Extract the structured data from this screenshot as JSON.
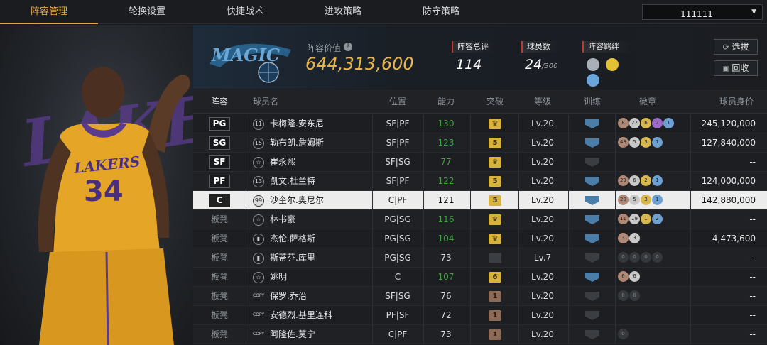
{
  "nav": {
    "tabs": [
      "阵容管理",
      "轮换设置",
      "快捷战术",
      "进攻策略",
      "防守策略"
    ],
    "active": 0,
    "selector_value": "111111"
  },
  "header": {
    "value_label": "阵容价值",
    "value": "644,313,600",
    "rating_label": "阵容总评",
    "rating": "114",
    "count_label": "球员数",
    "count": "24",
    "count_max": "/300",
    "bond_label": "阵容羁绊",
    "select_btn": "选拔",
    "recycle_btn": "回收"
  },
  "columns": {
    "lineup": "阵容",
    "name": "球员名",
    "pos": "位置",
    "ability": "能力",
    "breakthrough": "突破",
    "level": "等级",
    "training": "训练",
    "badge": "徽章",
    "value": "球员身价"
  },
  "rows": [
    {
      "slot": "PG",
      "bench": false,
      "icon": "11",
      "name": "卡梅隆.安东尼",
      "pos": "SF|PF",
      "ability": "130",
      "green": true,
      "bt": "crown",
      "btc": "gold",
      "lv": "Lv.20",
      "train": true,
      "badges": [
        [
          "8",
          "br"
        ],
        [
          "22",
          "sv"
        ],
        [
          "6",
          "gd"
        ],
        [
          "2",
          "pu"
        ],
        [
          "1",
          "bl"
        ]
      ],
      "value": "245,120,000"
    },
    {
      "slot": "SG",
      "bench": false,
      "icon": "15",
      "name": "勒布朗.詹姆斯",
      "pos": "SF|PF",
      "ability": "123",
      "green": true,
      "bt": "5",
      "btc": "gold",
      "lv": "Lv.20",
      "train": true,
      "badges": [
        [
          "48",
          "br"
        ],
        [
          "5",
          "sv"
        ],
        [
          "3",
          "gd"
        ],
        [
          "1",
          "bl"
        ]
      ],
      "value": "127,840,000"
    },
    {
      "slot": "SF",
      "bench": false,
      "icon": "☆",
      "name": "崔永熙",
      "pos": "SF|SG",
      "ability": "77",
      "green": true,
      "bt": "crown",
      "btc": "gold",
      "lv": "Lv.20",
      "train": false,
      "badges": [],
      "value": "--"
    },
    {
      "slot": "PF",
      "bench": false,
      "icon": "13",
      "name": "凯文.杜兰特",
      "pos": "SF|PF",
      "ability": "122",
      "green": true,
      "bt": "5",
      "btc": "gold",
      "lv": "Lv.20",
      "train": true,
      "badges": [
        [
          "29",
          "br"
        ],
        [
          "6",
          "sv"
        ],
        [
          "2",
          "gd"
        ],
        [
          "1",
          "bl"
        ]
      ],
      "value": "124,000,000"
    },
    {
      "slot": "C",
      "bench": false,
      "sel": true,
      "icon": "99",
      "name": "沙奎尔.奥尼尔",
      "pos": "C|PF",
      "ability": "121",
      "green": false,
      "bt": "5",
      "btc": "gold",
      "lv": "Lv.20",
      "train": true,
      "badges": [
        [
          "20",
          "br"
        ],
        [
          "5",
          "sv"
        ],
        [
          "3",
          "gd"
        ],
        [
          "1",
          "bl"
        ]
      ],
      "value": "142,880,000"
    },
    {
      "slot": "板凳",
      "bench": true,
      "icon": "☆",
      "name": "林书豪",
      "pos": "PG|SG",
      "ability": "116",
      "green": true,
      "bt": "crown",
      "btc": "gold",
      "lv": "Lv.20",
      "train": true,
      "badges": [
        [
          "11",
          "br"
        ],
        [
          "19",
          "sv"
        ],
        [
          "1",
          "gd"
        ],
        [
          "2",
          "bl"
        ]
      ],
      "value": "--"
    },
    {
      "slot": "板凳",
      "bench": true,
      "icon": "▮",
      "name": "杰伦.萨格斯",
      "pos": "PG|SG",
      "ability": "104",
      "green": true,
      "bt": "crown",
      "btc": "gold",
      "lv": "Lv.20",
      "train": true,
      "badges": [
        [
          "3",
          "br"
        ],
        [
          "3",
          "sv"
        ]
      ],
      "value": "4,473,600"
    },
    {
      "slot": "板凳",
      "bench": true,
      "icon": "▮",
      "name": "斯蒂芬.库里",
      "pos": "PG|SG",
      "ability": "73",
      "green": false,
      "bt": "",
      "btc": "gray",
      "lv": "Lv.7",
      "train": false,
      "badges": [
        [
          "0",
          "dk"
        ],
        [
          "0",
          "dk"
        ],
        [
          "0",
          "dk"
        ],
        [
          "0",
          "dk"
        ]
      ],
      "value": "--"
    },
    {
      "slot": "板凳",
      "bench": true,
      "icon": "☆",
      "name": "姚明",
      "pos": "C",
      "ability": "107",
      "green": true,
      "bt": "6",
      "btc": "gold",
      "lv": "Lv.20",
      "train": true,
      "badges": [
        [
          "6",
          "br"
        ],
        [
          "6",
          "sv"
        ]
      ],
      "value": "--"
    },
    {
      "slot": "板凳",
      "bench": true,
      "icon": "COPY",
      "name": "保罗.乔治",
      "pos": "SF|SG",
      "ability": "76",
      "green": false,
      "bt": "1",
      "btc": "bronze",
      "lv": "Lv.20",
      "train": false,
      "badges": [
        [
          "0",
          "dk"
        ],
        [
          "0",
          "dk"
        ]
      ],
      "value": "--"
    },
    {
      "slot": "板凳",
      "bench": true,
      "icon": "COPY",
      "name": "安德烈.基里连科",
      "pos": "PF|SF",
      "ability": "72",
      "green": false,
      "bt": "1",
      "btc": "bronze",
      "lv": "Lv.20",
      "train": false,
      "badges": [],
      "value": "--"
    },
    {
      "slot": "板凳",
      "bench": true,
      "icon": "COPY",
      "name": "阿隆佐.莫宁",
      "pos": "C|PF",
      "ability": "73",
      "green": false,
      "bt": "1",
      "btc": "bronze",
      "lv": "Lv.20",
      "train": false,
      "badges": [
        [
          "0",
          "dk"
        ]
      ],
      "value": "--"
    }
  ],
  "player_art": {
    "jersey_team": "LAKERS",
    "jersey_number": "34",
    "bg_text": "LAKERS"
  },
  "team_logo_text": "MAGIC",
  "colors": {
    "accent": "#e0a84a",
    "gold_value": "#e8b54a",
    "green": "#3ea63e"
  }
}
